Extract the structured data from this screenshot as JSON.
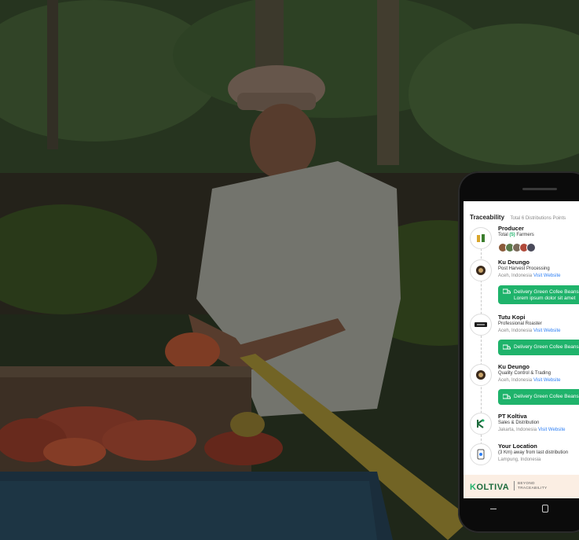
{
  "traceability": {
    "title": "Traceability",
    "subtitle": "Total 6 Distributions Points",
    "steps": [
      {
        "title": "Producer",
        "sub_prefix": "Total ",
        "count": "(5)",
        "sub_suffix": " Farmers"
      },
      {
        "title": "Ku Deungo",
        "role": "Post Harvest Processing",
        "location": "Aceh, Indonesia",
        "link": "Visit Website"
      },
      {
        "title": "Tutu Kopi",
        "role": "Professional Roaster",
        "location": "Aceh, Indonesia",
        "link": "Visit Website"
      },
      {
        "title": "Ku Deungo",
        "role": "Quality Control & Trading",
        "location": "Aceh, Indonesia",
        "link": "Visit Website"
      },
      {
        "title": "PT Koltiva",
        "role": "Sales & Distribution",
        "location": "Jakarta, Indonesia",
        "link": "Visit Website"
      },
      {
        "title": "Your Location",
        "role": "(3 Km) away from last distribution",
        "location": "Lampung, Indonesia"
      }
    ],
    "chips": [
      {
        "line1": "Delivery Green Cofee Beans",
        "line2": "Lorem ipsum dolor sit amet"
      },
      {
        "line1": "Delivery Green Cofee Beans"
      },
      {
        "line1": "Delivery Green Cofee Beans"
      }
    ]
  },
  "footer": {
    "logo_k": "K",
    "logo_rest": "OLTIVA",
    "tagline_1": "BEYOND",
    "tagline_2": "TRACEABILITY"
  },
  "colors": {
    "accent": "#1fb36b",
    "link": "#2d7ff5"
  },
  "icons": [
    "producer-icon",
    "processor-icon",
    "roaster-icon",
    "trader-icon",
    "koltiva-icon",
    "location-icon",
    "truck-icon"
  ]
}
